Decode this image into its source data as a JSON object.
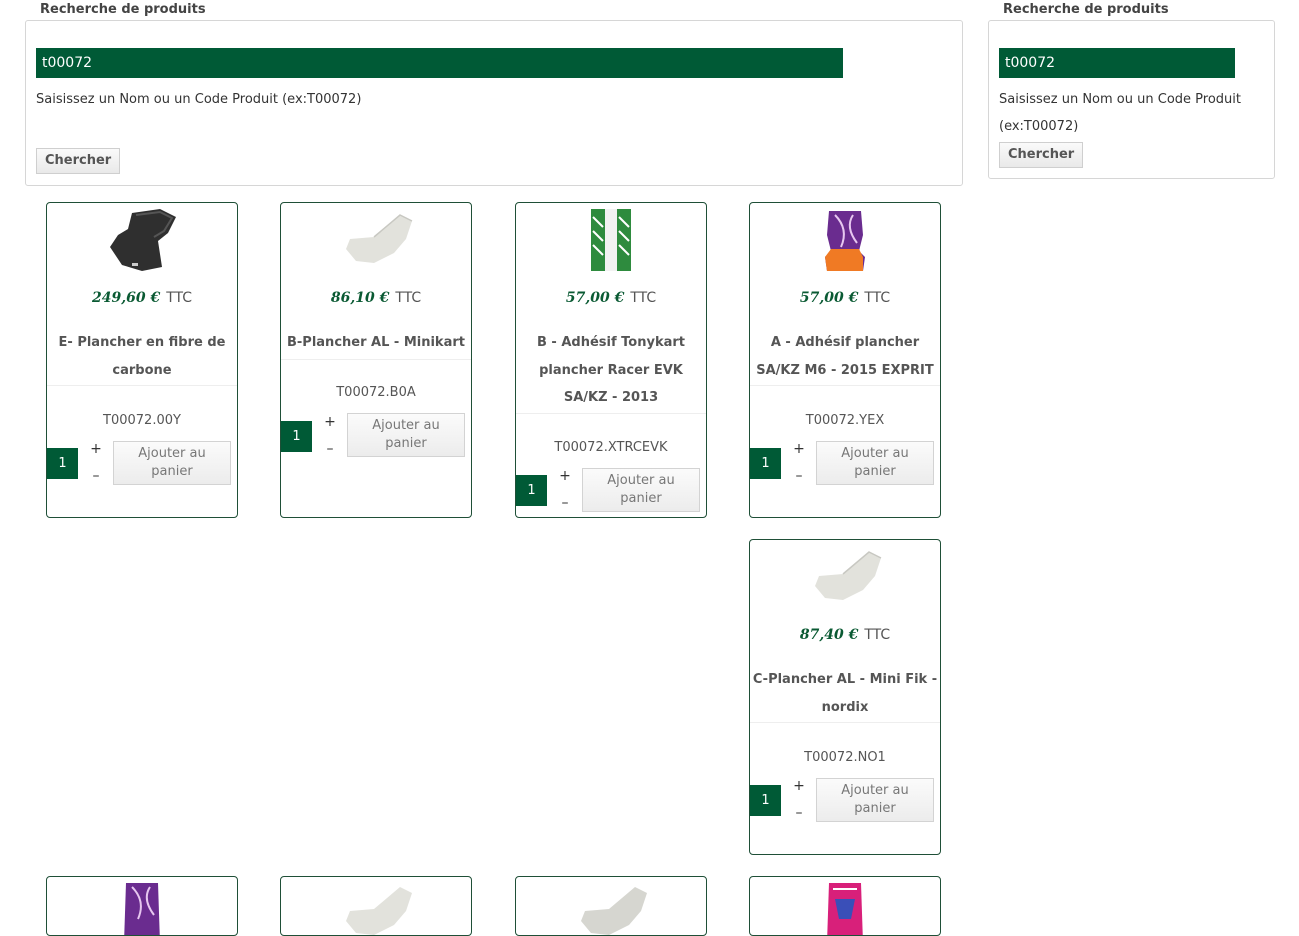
{
  "search_main": {
    "legend": "Recherche de produits",
    "value": "t00072",
    "hint": "Saisissez un Nom ou un Code Produit (ex:T00072)",
    "button": "Chercher"
  },
  "search_side": {
    "legend": "Recherche de produits",
    "value": "t00072",
    "hint_line1": "Saisissez un Nom ou un Code Produit",
    "hint_line2": "(ex:T00072)",
    "button": "Chercher"
  },
  "ttc_label": "TTC",
  "add_label_1": "Ajouter au",
  "add_label_2": "panier",
  "plus": "+",
  "minus": "–",
  "products": [
    {
      "price": "249,60 €",
      "name": "E- Plancher en fibre de carbone",
      "code": "T00072.00Y",
      "qty": "1",
      "thumb": "black-floor-tray"
    },
    {
      "price": "86,10 €",
      "name": "B-Plancher AL - Minikart",
      "code": "T00072.B0A",
      "qty": "1",
      "thumb": "aluminium-floor-tray"
    },
    {
      "price": "57,00 €",
      "name": "B - Adhésif Tonykart plancher Racer EVK SA/KZ - 2013",
      "code": "T00072.XTRCEVK",
      "qty": "1",
      "thumb": "green-sticker"
    },
    {
      "price": "57,00 €",
      "name": "A - Adhésif plancher SA/KZ M6 - 2015 EXPRIT",
      "code": "T00072.YEX",
      "qty": "1",
      "thumb": "purple-orange-sticker"
    },
    {
      "price": "87,40 €",
      "name": "C-Plancher AL - Mini Fik - nordix",
      "code": "T00072.NO1",
      "qty": "1",
      "thumb": "aluminium-floor-tray"
    }
  ]
}
